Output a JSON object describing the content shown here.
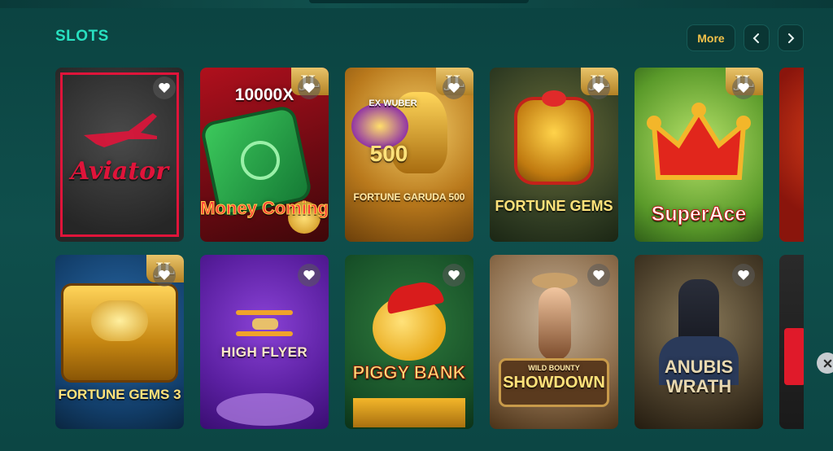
{
  "section": {
    "title": "SLOTS"
  },
  "controls": {
    "more_label": "More"
  },
  "colors": {
    "accent": "#28e0c0",
    "button_text": "#f3c24a",
    "background": "#0e4a48"
  },
  "badge_text": "JL",
  "games": [
    {
      "title": "Aviator",
      "provider_badge": false
    },
    {
      "title": "10000X",
      "subtitle": "Money Coming",
      "provider_badge": true
    },
    {
      "title": "500",
      "subtitle": "FORTUNE GARUDA 500",
      "extra": "EX WUBER",
      "provider_badge": true
    },
    {
      "title": "FORTUNE GEMS",
      "provider_badge": true
    },
    {
      "title": "SuperAce",
      "provider_badge": true
    },
    {
      "title": "FORTUNE GEMS 3",
      "provider_badge": true
    },
    {
      "title": "HIGH FLYER",
      "provider_badge": false
    },
    {
      "title": "PIGGY BANK",
      "provider_badge": false
    },
    {
      "title": "SHOWDOWN",
      "kicker": "WILD BOUNTY",
      "provider_badge": false
    },
    {
      "title": "ANUBIS WRATH",
      "line1": "ANUBIS",
      "line2": "WRATH",
      "provider_badge": false
    }
  ]
}
